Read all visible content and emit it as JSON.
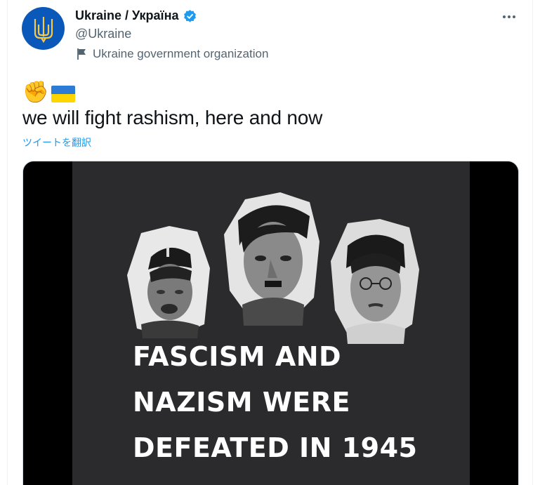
{
  "account": {
    "display_name": "Ukraine / Україна",
    "handle": "@Ukraine",
    "label": "Ukraine government organization",
    "verified_icon": "verified-badge-icon",
    "colors": {
      "avatar_bg": "#0a58b9",
      "trident": "#f7c948",
      "verified": "#1d9bf0"
    }
  },
  "tweet": {
    "emojis": [
      "✊",
      "🇺🇦"
    ],
    "text": "we will fight rashism, here and now",
    "translate_link": "ツイートを翻訳"
  },
  "media": {
    "headline_lines": [
      "FASCISM AND",
      "NAZISM WERE",
      "DEFEATED IN 1945"
    ],
    "portraits": [
      "mussolini-portrait",
      "hitler-portrait",
      "hirohito-portrait"
    ]
  }
}
